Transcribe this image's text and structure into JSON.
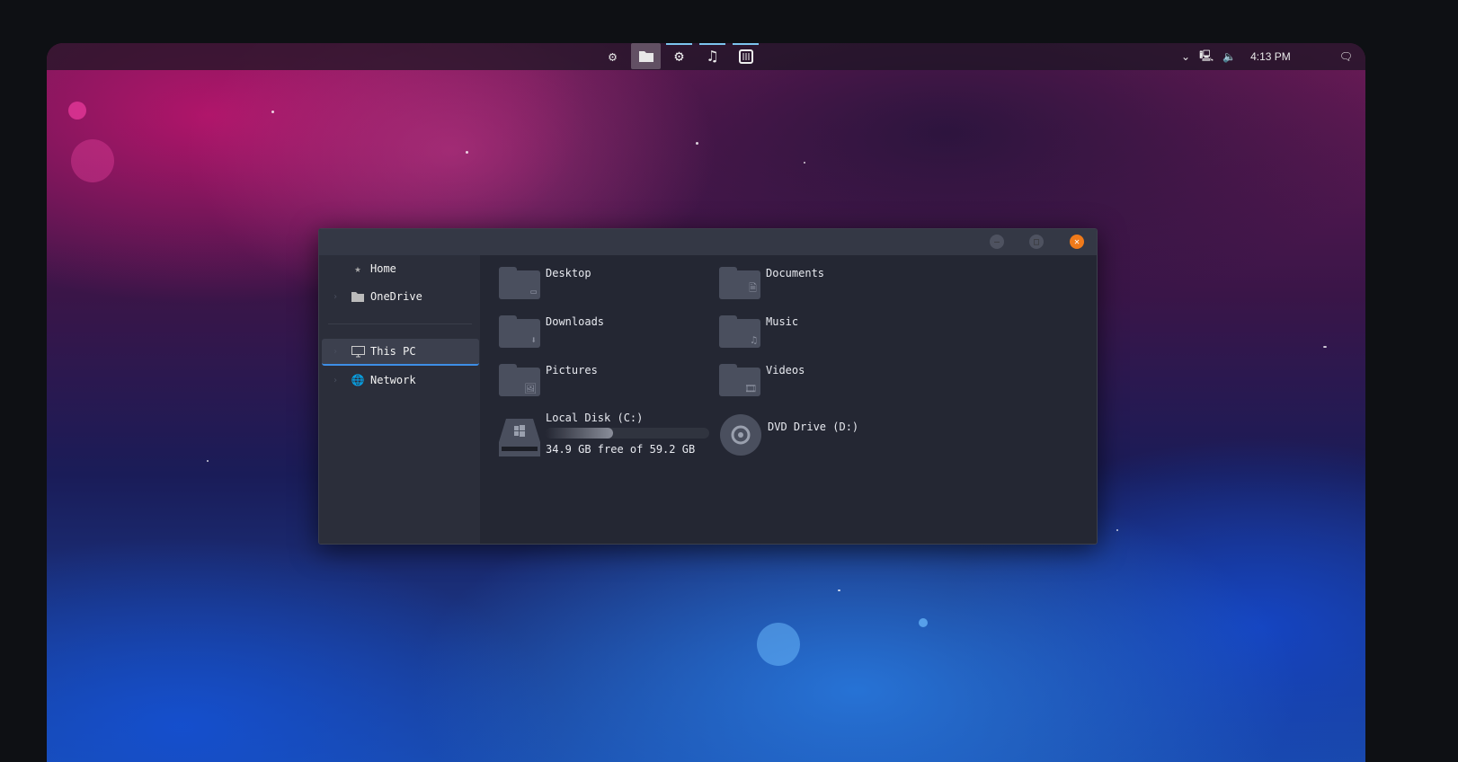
{
  "taskbar": {
    "icons": [
      "ubuntu-icon",
      "folder-icon",
      "gear-icon",
      "music-icon",
      "mixer-icon"
    ],
    "time": "4:13 PM"
  },
  "window": {
    "sidebar": [
      {
        "label": "Home"
      },
      {
        "label": "OneDrive"
      },
      {
        "label": "This PC"
      },
      {
        "label": "Network"
      }
    ],
    "folders": [
      {
        "label": "Desktop"
      },
      {
        "label": "Documents"
      },
      {
        "label": "Downloads"
      },
      {
        "label": "Music"
      },
      {
        "label": "Pictures"
      },
      {
        "label": "Videos"
      }
    ],
    "drives": {
      "c": {
        "label": "Local Disk (C:)",
        "status": "34.9 GB free of 59.2 GB",
        "used_fraction": 0.41
      },
      "d": {
        "label": "DVD Drive (D:)"
      }
    }
  },
  "colors": {
    "accent": "#3d8ee6",
    "close": "#f07a1a"
  }
}
